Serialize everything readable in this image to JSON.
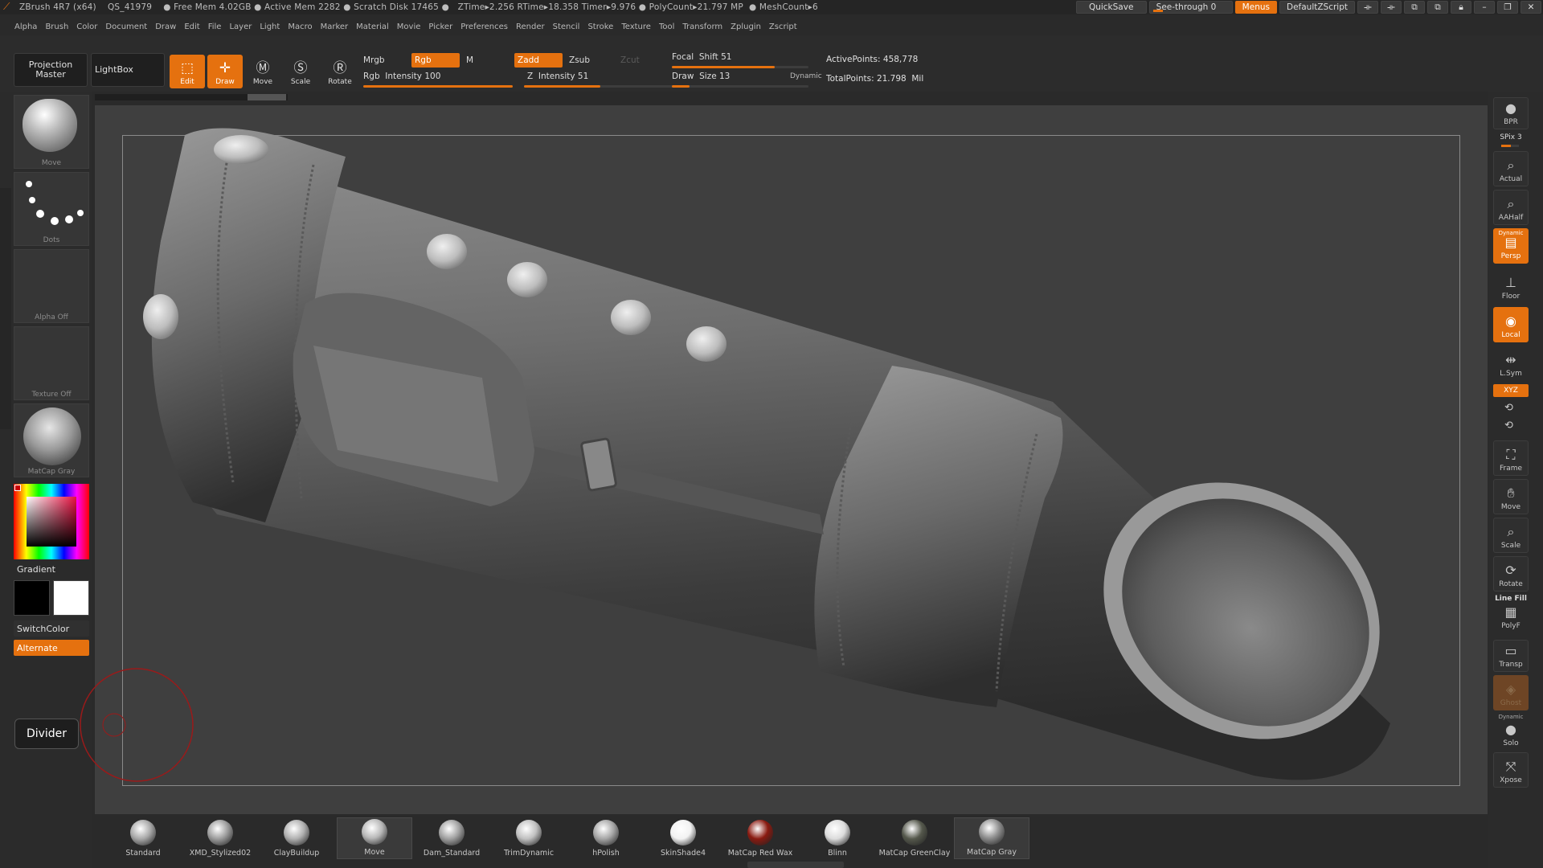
{
  "titlebar": {
    "text": "ZBrush 4R7 (x64)    QS_41979    ● Free Mem 4.02GB ● Active Mem 2282 ● Scratch Disk 17465 ●   ZTime▸2.256 RTime▸18.358 Timer▸9.976 ● PolyCount▸21.797 MP  ● MeshCount▸6",
    "quicksave": "QuickSave",
    "seethrough": "See-through   0",
    "menus": "Menus",
    "script": "DefaultZScript"
  },
  "menubar": [
    "Alpha",
    "Brush",
    "Color",
    "Document",
    "Draw",
    "Edit",
    "File",
    "Layer",
    "Light",
    "Macro",
    "Marker",
    "Material",
    "Movie",
    "Picker",
    "Preferences",
    "Render",
    "Stencil",
    "Stroke",
    "Texture",
    "Tool",
    "Transform",
    "Zplugin",
    "Zscript"
  ],
  "shelf": {
    "projection_master": "Projection Master",
    "lightbox": "LightBox",
    "edit": "Edit",
    "draw": "Draw",
    "move": "Move",
    "scale": "Scale",
    "rotate": "Rotate",
    "mrgb": "Mrgb",
    "rgb": "Rgb",
    "m": "M",
    "zadd": "Zadd",
    "zsub": "Zsub",
    "zcut": "Zcut",
    "rgb_intensity": "Rgb  Intensity 100",
    "z_intensity": "Z  Intensity 51",
    "focal_shift": "Focal  Shift 51",
    "draw_size": "Draw  Size 13",
    "dynamic": "Dynamic",
    "active_points": "ActivePoints: 458,778",
    "total_points": "TotalPoints: 21.798  Mil",
    "rgb_intensity_level": 1.0,
    "z_intensity_level": 0.51,
    "focal_shift_level": 0.75,
    "draw_size_level": 0.13
  },
  "left": {
    "brush": "Move",
    "stroke": "Dots",
    "alpha": "Alpha  Off",
    "texture": "Texture  Off",
    "material": "MatCap  Gray",
    "gradient": "Gradient",
    "switchcolor": "SwitchColor",
    "alternate": "Alternate",
    "divider": "Divider"
  },
  "right": {
    "bpr": "BPR",
    "spix": "SPix 3",
    "actual": "Actual",
    "aahalf": "AAHalf",
    "dynamic": "Dynamic",
    "persp": "Persp",
    "floor": "Floor",
    "local": "Local",
    "lsym": "L.Sym",
    "xyz": "XYZ",
    "frame": "Frame",
    "move": "Move",
    "scale": "Scale",
    "rotate": "Rotate",
    "linefill": "Line Fill",
    "polyf": "PolyF",
    "transp": "Transp",
    "ghost": "Ghost",
    "dynamic2": "Dynamic",
    "solo": "Solo",
    "xpose": "Xpose"
  },
  "bottom_shelf": [
    {
      "label": "Standard",
      "color": "#a8a8a8"
    },
    {
      "label": "XMD_Stylized02",
      "color": "#9c9c9c"
    },
    {
      "label": "ClayBuildup",
      "color": "#b0b0b0"
    },
    {
      "label": "Move",
      "color": "#b8b8b8"
    },
    {
      "label": "Dam_Standard",
      "color": "#a0a0a0"
    },
    {
      "label": "TrimDynamic",
      "color": "#c0c0c0"
    },
    {
      "label": "hPolish",
      "color": "#a6a6a6"
    },
    {
      "label": "SkinShade4",
      "color": "#f2f2f2"
    },
    {
      "label": "MatCap  Red  Wax",
      "color": "#8a1a10"
    },
    {
      "label": "Blinn",
      "color": "#dcdcdc"
    },
    {
      "label": "MatCap  GreenClay",
      "color": "#55584c"
    },
    {
      "label": "MatCap  Gray",
      "color": "#8e8e8e"
    }
  ],
  "colors": {
    "accent": "#e5710f",
    "background": "#2a2a2a",
    "viewport": "#3f3f3f"
  }
}
